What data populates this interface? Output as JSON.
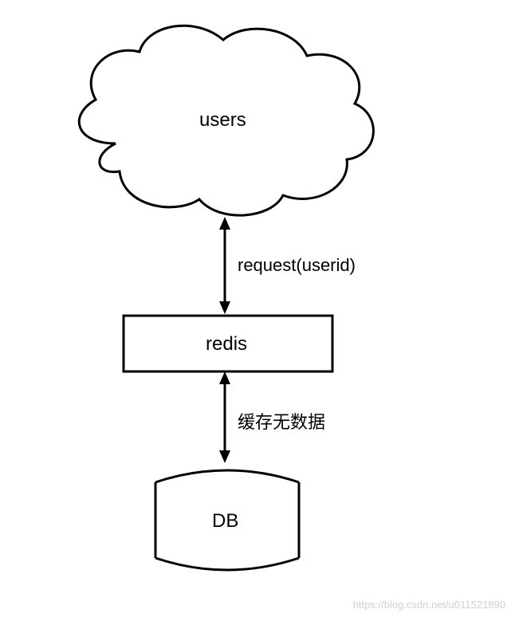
{
  "nodes": {
    "users": {
      "label": "users",
      "type": "cloud"
    },
    "redis": {
      "label": "redis",
      "type": "rectangle"
    },
    "db": {
      "label": "DB",
      "type": "database"
    }
  },
  "edges": {
    "users_redis": {
      "label": "request(userid)"
    },
    "redis_db": {
      "label": "缓存无数据"
    }
  },
  "watermark": "https://blog.csdn.net/u011521890"
}
